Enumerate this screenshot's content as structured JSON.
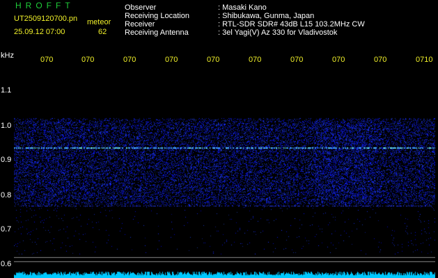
{
  "header": {
    "title": "HROFFT",
    "filename": "UT2509120700.pn",
    "mode": "meteor",
    "datetime": "25.09.12 07:00",
    "count": "62",
    "labels": [
      "Observer",
      "Receiving Location",
      "Receiver",
      "Receiving Antenna"
    ],
    "values": [
      ": Masaki Kano",
      ": Shibukawa, Gunma, Japan",
      ": RTL-SDR SDR# 43dB L15 103.2MHz CW",
      ": 3el Yagi(V) Az 330 for Vladivostok"
    ]
  },
  "axis": {
    "unit": "kHz",
    "freq_labels": [
      "1.1",
      "1.0",
      "0.9",
      "0.8",
      "0.7",
      "0.6"
    ],
    "time_labels": [
      "070",
      "070",
      "070",
      "070",
      "070",
      "070",
      "070",
      "070",
      "070",
      "0710"
    ]
  },
  "colors": {
    "background": "#000000",
    "header_text": "#ffffff",
    "highlight": "#f2f22a",
    "title": "#1fcf3a",
    "signal": "#2a3cff",
    "bottom_bar": "#00c8ff"
  }
}
